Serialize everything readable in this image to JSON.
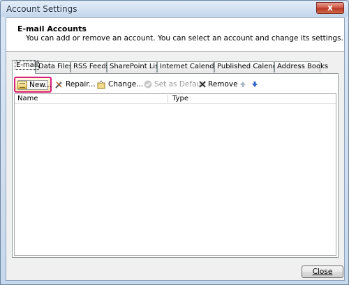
{
  "window": {
    "title": "Account Settings",
    "close_glyph": "x"
  },
  "header": {
    "title": "E-mail Accounts",
    "description": "You can add or remove an account. You can select an account and change its settings."
  },
  "tabs": [
    {
      "label": "E-mail",
      "active": true
    },
    {
      "label": "Data Files"
    },
    {
      "label": "RSS Feeds"
    },
    {
      "label": "SharePoint Lists"
    },
    {
      "label": "Internet Calendars"
    },
    {
      "label": "Published Calendars"
    },
    {
      "label": "Address Books"
    }
  ],
  "toolbar": {
    "new_label": "New...",
    "repair_label": "Repair...",
    "change_label": "Change...",
    "set_default_label": "Set as Default",
    "remove_label": "Remove",
    "move_up_icon": "arrow-up-icon",
    "move_down_icon": "arrow-down-icon"
  },
  "accounts_list": {
    "columns": [
      "Name",
      "Type"
    ],
    "rows": []
  },
  "footer": {
    "close_label": "Close"
  },
  "colors": {
    "highlight_border": "#d81f7a",
    "title_bar": "#d2e1f2"
  }
}
